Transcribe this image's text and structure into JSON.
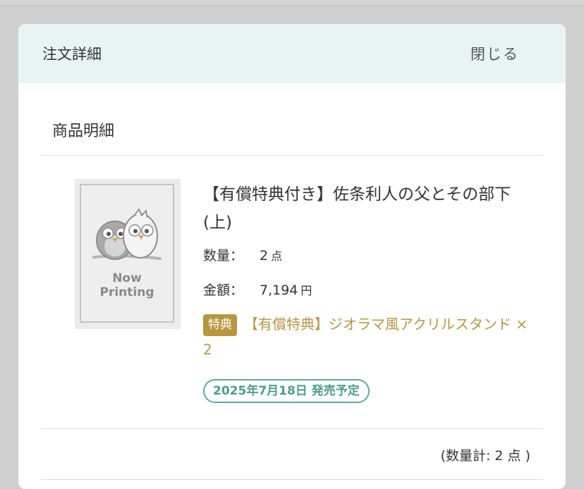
{
  "modal": {
    "title": "注文詳細",
    "close_label": "閉じる"
  },
  "section": {
    "title": "商品明細"
  },
  "item": {
    "thumbnail_text_line1": "Now",
    "thumbnail_text_line2": "Printing",
    "title": "【有償特典付き】佐条利人の父とその部下(上)",
    "quantity_label": "数量：",
    "quantity_value": "2",
    "quantity_unit": "点",
    "price_label": "金額：",
    "price_value": "7,194",
    "price_unit": "円",
    "bonus_badge": "特典",
    "bonus_text": "【有償特典】ジオラマ風アクリルスタンド × 2",
    "release_badge": "2025年7月18日 発売予定"
  },
  "total": {
    "text": "(数量計: 2 点 )"
  },
  "colors": {
    "header_bg": "#e8f4f2",
    "bonus_gold": "#b8963f",
    "release_green": "#5aaa98"
  }
}
